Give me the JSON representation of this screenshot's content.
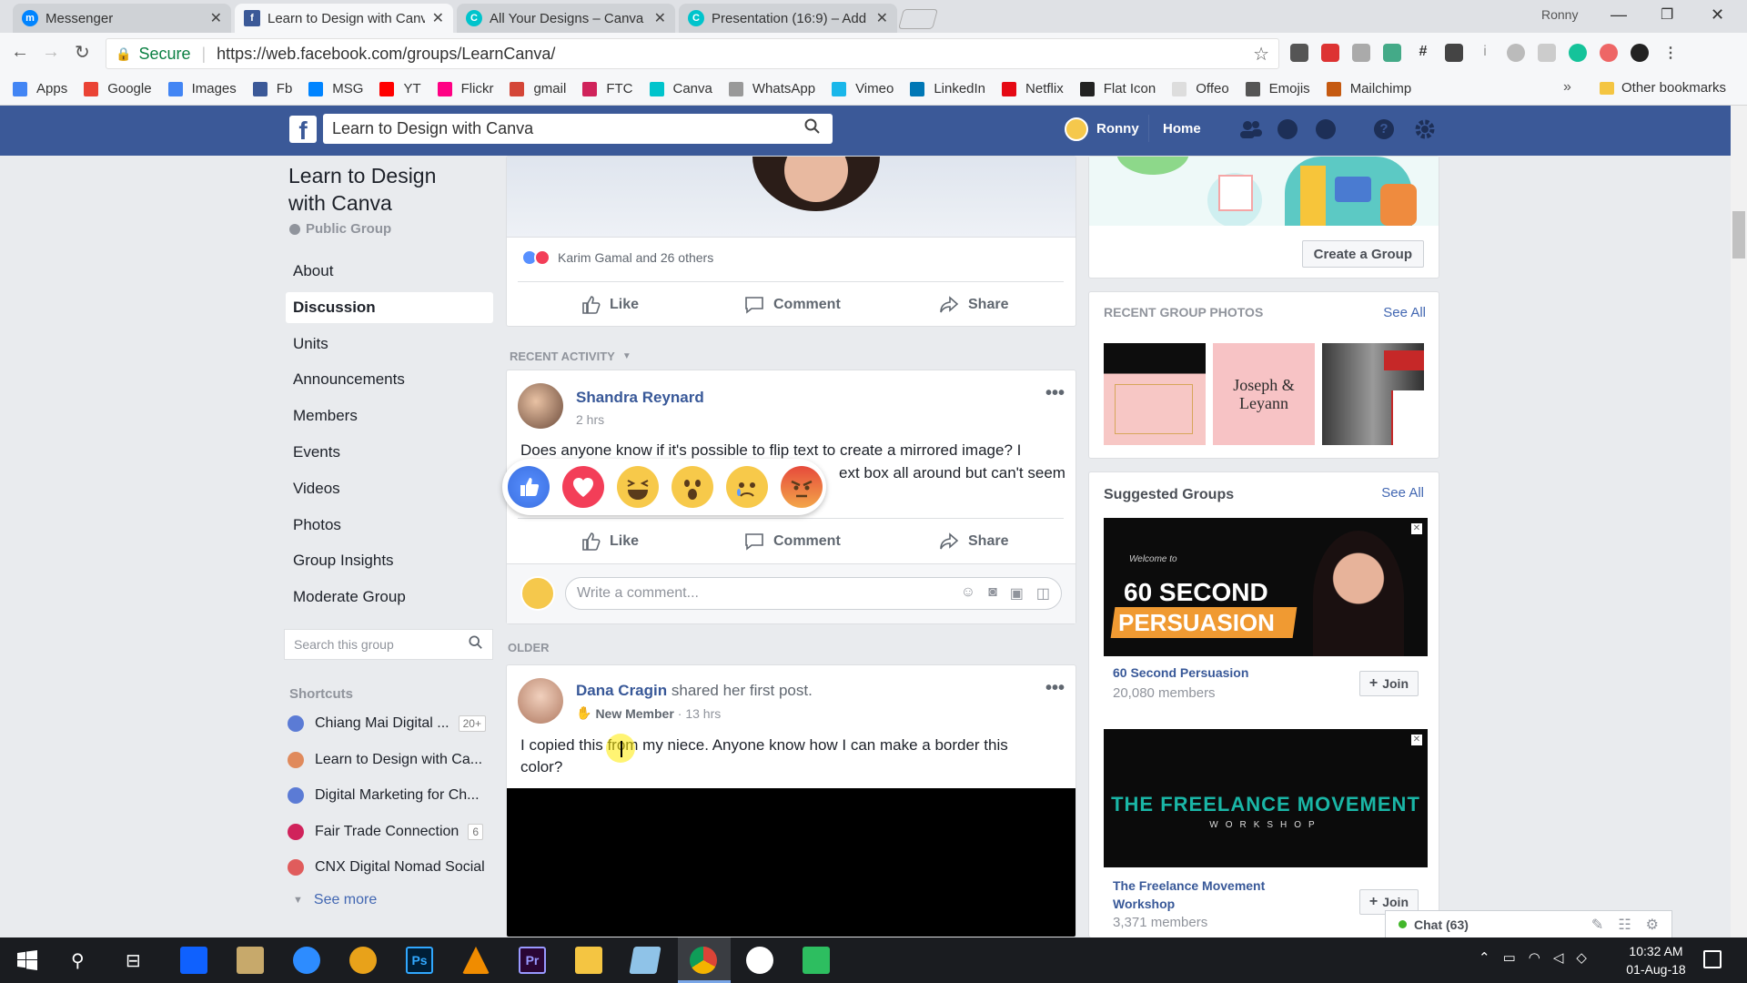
{
  "browser": {
    "tabs": [
      {
        "title": "Messenger",
        "active": false,
        "icon": "messenger-icon"
      },
      {
        "title": "Learn to Design with Canva",
        "active": true,
        "icon": "facebook-icon"
      },
      {
        "title": "All Your Designs – Canva",
        "active": false,
        "icon": "canva-icon"
      },
      {
        "title": "Presentation (16:9) – Add",
        "active": false,
        "icon": "canva-icon"
      }
    ],
    "profile_name": "Ronny",
    "secure_label": "Secure",
    "url": "https://web.facebook.com/groups/LearnCanva/",
    "bookmarks": [
      {
        "label": "Apps",
        "color": "#4285f4"
      },
      {
        "label": "Google",
        "color": "#ea4335"
      },
      {
        "label": "Images",
        "color": "#4285f4"
      },
      {
        "label": "Fb",
        "color": "#3b5998"
      },
      {
        "label": "MSG",
        "color": "#0084ff"
      },
      {
        "label": "YT",
        "color": "#ff0000"
      },
      {
        "label": "Flickr",
        "color": "#ff0084"
      },
      {
        "label": "gmail",
        "color": "#d44638"
      },
      {
        "label": "FTC",
        "color": "#d0235b"
      },
      {
        "label": "Canva",
        "color": "#00c4cc"
      },
      {
        "label": "WhatsApp",
        "color": "#999999"
      },
      {
        "label": "Vimeo",
        "color": "#1ab7ea"
      },
      {
        "label": "LinkedIn",
        "color": "#0077b5"
      },
      {
        "label": "Netflix",
        "color": "#e50914"
      },
      {
        "label": "Flat Icon",
        "color": "#222222"
      },
      {
        "label": "Offeo",
        "color": "#dddddd"
      },
      {
        "label": "Emojis",
        "color": "#555555"
      },
      {
        "label": "Mailchimp",
        "color": "#c55a11"
      }
    ],
    "more_bookmarks": "»",
    "other_bookmarks": "Other bookmarks"
  },
  "fb": {
    "search_value": "Learn to Design with Canva",
    "user_name": "Ronny",
    "home_label": "Home"
  },
  "group": {
    "title_line1": "Learn to Design",
    "title_line2": "with Canva",
    "privacy": "Public Group",
    "nav": [
      {
        "label": "About",
        "active": false
      },
      {
        "label": "Discussion",
        "active": true
      },
      {
        "label": "Units",
        "active": false
      },
      {
        "label": "Announcements",
        "active": false
      },
      {
        "label": "Members",
        "active": false
      },
      {
        "label": "Events",
        "active": false
      },
      {
        "label": "Videos",
        "active": false
      },
      {
        "label": "Photos",
        "active": false
      },
      {
        "label": "Group Insights",
        "active": false
      },
      {
        "label": "Moderate Group",
        "active": false
      }
    ],
    "search_placeholder": "Search this group",
    "shortcuts_title": "Shortcuts",
    "shortcuts": [
      {
        "label": "Chiang Mai Digital ...",
        "count": "20+",
        "color": "#5b7bd5"
      },
      {
        "label": "Learn to Design with Ca...",
        "count": "",
        "color": "#e08a5c"
      },
      {
        "label": "Digital Marketing for Ch...",
        "count": "",
        "color": "#5b7bd5"
      },
      {
        "label": "Fair Trade Connection",
        "count": "6",
        "color": "#d0235b"
      },
      {
        "label": "CNX Digital Nomad Social",
        "count": "",
        "color": "#e05c5c"
      }
    ],
    "see_more": "See more"
  },
  "feed": {
    "post1": {
      "reactions_text": "Karim Gamal and 26 others",
      "like": "Like",
      "comment": "Comment",
      "share": "Share"
    },
    "recent_activity": "RECENT ACTIVITY",
    "post2": {
      "author": "Shandra Reynard",
      "time": "2 hrs",
      "text_line1": "Does anyone know if it's possible to flip text to create a mirrored image? I",
      "text_line2_visible": "ext box all around but can't seem",
      "like": "Like",
      "comment": "Comment",
      "share": "Share",
      "comment_placeholder": "Write a comment..."
    },
    "older_label": "OLDER",
    "post3": {
      "author": "Dana Cragin",
      "action": "shared her first post.",
      "badge": "New Member",
      "time": "· 13 hrs",
      "text_line1": "I copied this from my niece. Anyone know how I can make a border this",
      "text_line2": "color?"
    }
  },
  "sidebar": {
    "create_group": "Create a Group",
    "recent_photos_title": "RECENT GROUP PHOTOS",
    "see_all": "See All",
    "photo2_text": "Joseph & Leyann",
    "suggested_title": "Suggested Groups",
    "suggested": [
      {
        "name": "60 Second Persuasion",
        "members": "20,080 members",
        "join": "Join",
        "banner_top": "Welcome to",
        "banner_line1": "60 SECOND",
        "banner_line2": "PERSUASION"
      },
      {
        "name_line1": "The Freelance Movement",
        "name_line2": "Workshop",
        "members": "3,371 members",
        "join": "Join",
        "banner_line1": "THE FREELANCE MOVEMENT",
        "banner_line2": "WORKSHOP"
      }
    ],
    "chat_label": "Chat (63)"
  },
  "taskbar": {
    "time": "10:32 AM",
    "date": "01-Aug-18"
  }
}
